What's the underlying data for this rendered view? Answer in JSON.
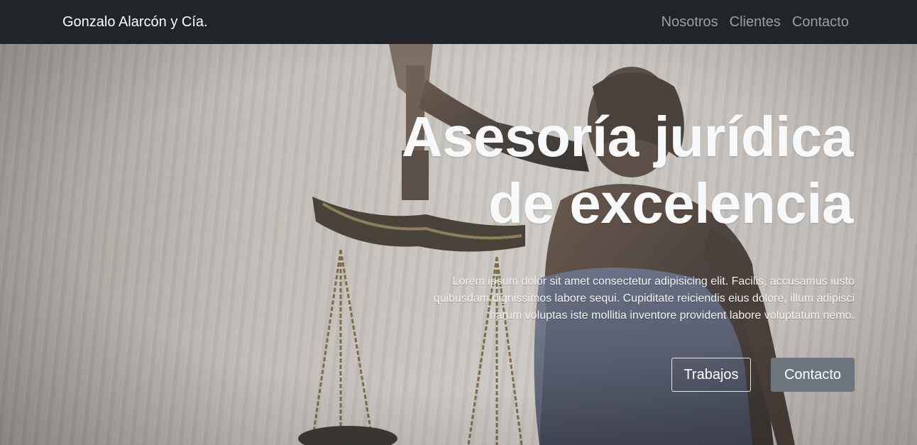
{
  "navbar": {
    "brand": "Gonzalo Alarcón y Cía.",
    "links": [
      {
        "label": "Nosotros"
      },
      {
        "label": "Clientes"
      },
      {
        "label": "Contacto"
      }
    ]
  },
  "hero": {
    "title_line1": "Asesoría jurídica",
    "title_line2": "de excelencia",
    "lead": "Lorem ipsum dolor sit amet consectetur adipisicing elit. Facilis, accusamus iusto quibusdam dignissimos labore sequi. Cupiditate reiciendis eius dolore, illum adipisci harum voluptas iste mollitia inventore provident labore voluptatum nemo.",
    "buttons": {
      "primary_label": "Trabajos",
      "secondary_label": "Contacto"
    },
    "background_image": "lady-justice-statue-photo"
  },
  "colors": {
    "navbar_bg": "#212529",
    "secondary_button_bg": "#6c757d",
    "hero_text": "#f8f9fa"
  }
}
